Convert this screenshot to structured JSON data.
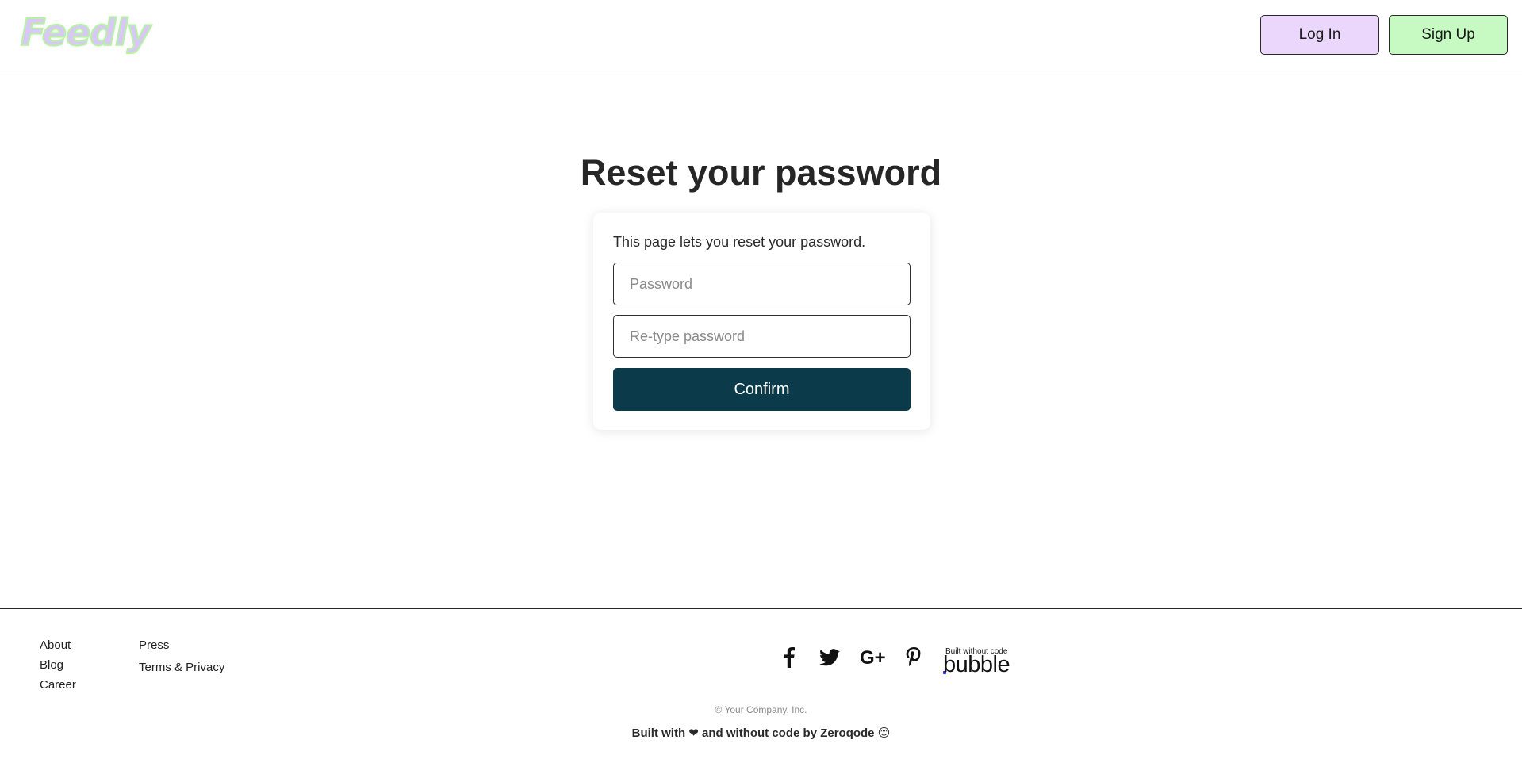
{
  "header": {
    "logo_text": "Feedly",
    "login_label": "Log In",
    "signup_label": "Sign Up",
    "login_bg": "#ead7fb",
    "signup_bg": "#c6fac2"
  },
  "main": {
    "title": "Reset your password",
    "description": "This page lets you reset your password.",
    "password_placeholder": "Password",
    "retype_placeholder": "Re-type password",
    "confirm_label": "Confirm",
    "confirm_bg": "#0b3b4a"
  },
  "footer": {
    "links_col1": [
      "About",
      "Blog",
      "Career"
    ],
    "links_col2": [
      "Press",
      "Terms & Privacy"
    ],
    "social_icons": [
      "facebook-icon",
      "twitter-icon",
      "google-plus-icon",
      "pinterest-icon"
    ],
    "bubble_small": "Built without code",
    "bubble_word": "bubble",
    "copyright": "© Your Company, Inc.",
    "built_with": "Built with ❤ and without code by Zeroqode 😊"
  }
}
